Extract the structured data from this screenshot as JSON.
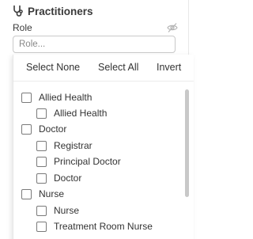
{
  "section": {
    "title": "Practitioners",
    "icon": "stethoscope-icon"
  },
  "role": {
    "label": "Role",
    "placeholder": "Role...",
    "visibility_icon": "eye-off-icon"
  },
  "actions": {
    "select_none": "Select None",
    "select_all": "Select All",
    "invert": "Invert"
  },
  "options": [
    {
      "label": "Allied Health",
      "level": 0,
      "checked": false
    },
    {
      "label": "Allied Health",
      "level": 1,
      "checked": false
    },
    {
      "label": "Doctor",
      "level": 0,
      "checked": false
    },
    {
      "label": "Registrar",
      "level": 1,
      "checked": false
    },
    {
      "label": "Principal Doctor",
      "level": 1,
      "checked": false
    },
    {
      "label": "Doctor",
      "level": 1,
      "checked": false
    },
    {
      "label": "Nurse",
      "level": 0,
      "checked": false
    },
    {
      "label": "Nurse",
      "level": 1,
      "checked": false
    },
    {
      "label": "Treatment Room Nurse",
      "level": 1,
      "checked": false
    }
  ]
}
